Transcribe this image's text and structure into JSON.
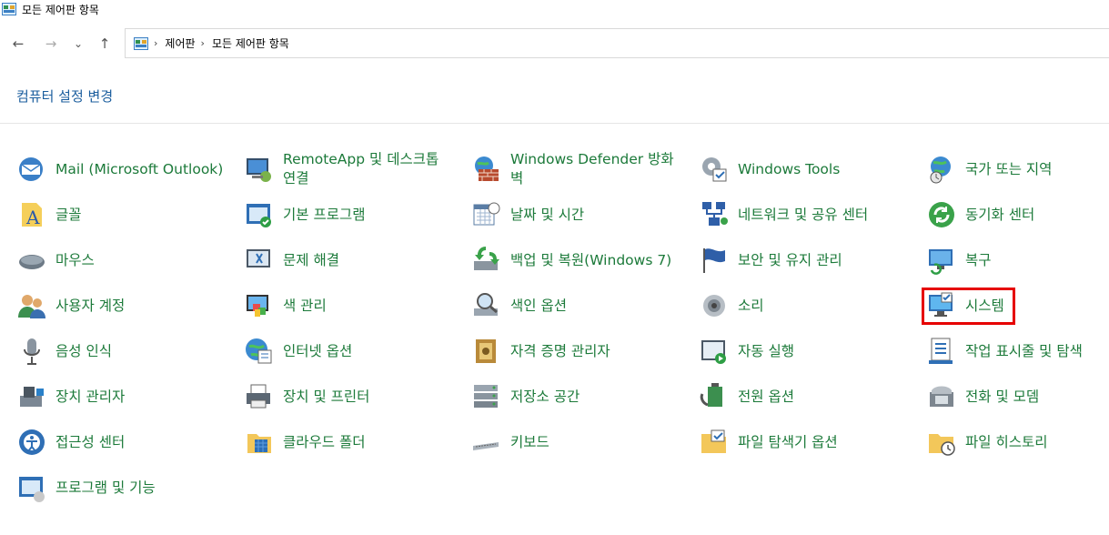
{
  "window": {
    "title": "모든 제어판 항목"
  },
  "nav": {
    "back": "←",
    "forward": "→",
    "recent": "⌄",
    "up": "↑",
    "breadcrumb": [
      "제어판",
      "모든 제어판 항목"
    ],
    "separator": "›"
  },
  "header": {
    "link": "컴퓨터 설정 변경"
  },
  "columns": [
    [
      "Mail (Microsoft Outlook)",
      "글꼴",
      "마우스",
      "사용자 계정",
      "음성 인식",
      "장치 관리자",
      "접근성 센터",
      "프로그램 및 기능"
    ],
    [
      "RemoteApp 및 데스크톱 연결",
      "기본 프로그램",
      "문제 해결",
      "색 관리",
      "인터넷 옵션",
      "장치 및 프린터",
      "클라우드 폴더"
    ],
    [
      "Windows Defender 방화벽",
      "날짜 및 시간",
      "백업 및 복원(Windows 7)",
      "색인 옵션",
      "자격 증명 관리자",
      "저장소 공간",
      "키보드"
    ],
    [
      "Windows Tools",
      "네트워크 및 공유 센터",
      "보안 및 유지 관리",
      "소리",
      "자동 실행",
      "전원 옵션",
      "파일 탐색기 옵션"
    ],
    [
      "국가 또는 지역",
      "동기화 센터",
      "복구",
      "시스템",
      "작업 표시줄 및 탐색",
      "전화 및 모뎀",
      "파일 히스토리"
    ]
  ],
  "icons": [
    [
      "mail-icon",
      "font-icon",
      "mouse-icon",
      "user-accounts-icon",
      "microphone-icon",
      "device-manager-icon",
      "ease-of-access-icon",
      "programs-icon"
    ],
    [
      "remoteapp-icon",
      "default-programs-icon",
      "troubleshoot-icon",
      "color-management-icon",
      "internet-options-icon",
      "printer-icon",
      "cloud-folder-icon"
    ],
    [
      "firewall-icon",
      "calendar-icon",
      "backup-icon",
      "indexing-icon",
      "credential-icon",
      "storage-icon",
      "keyboard-icon"
    ],
    [
      "tools-icon",
      "network-icon",
      "flag-icon",
      "speaker-icon",
      "autoplay-icon",
      "power-icon",
      "folder-options-icon"
    ],
    [
      "globe-icon",
      "sync-icon",
      "recovery-icon",
      "system-icon",
      "taskbar-icon",
      "phone-icon",
      "file-history-icon"
    ]
  ],
  "highlight": {
    "item": "시스템",
    "color": "#e60000"
  },
  "colors": {
    "link": "#1c7a3a",
    "header_link": "#1b5e9e"
  }
}
